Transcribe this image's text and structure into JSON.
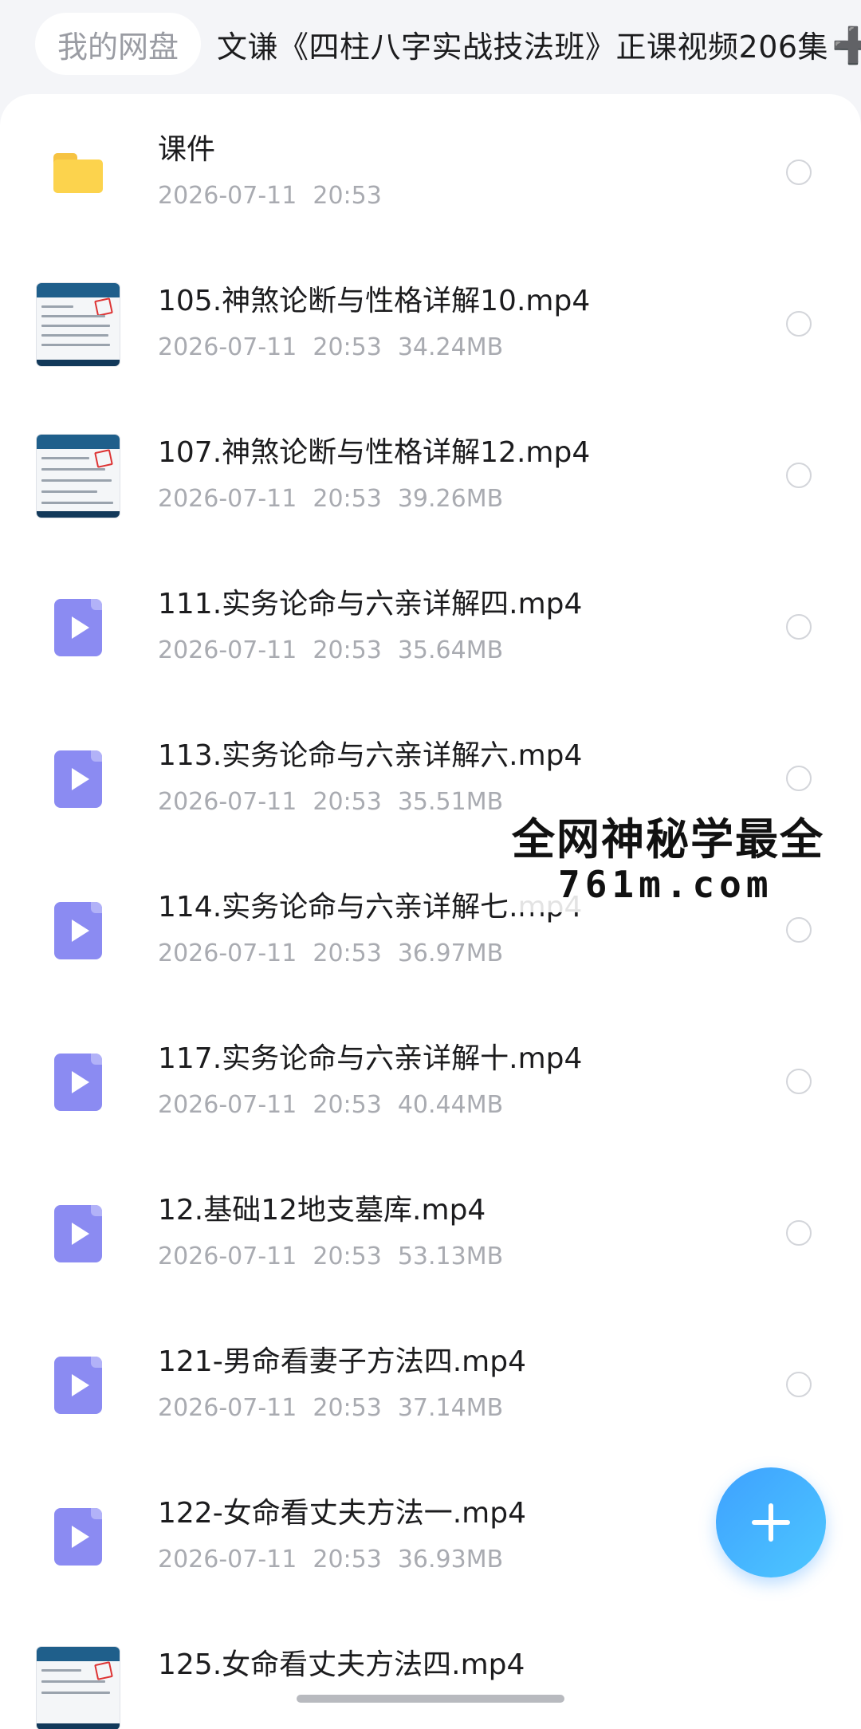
{
  "breadcrumb": {
    "home_label": "我的网盘",
    "current_folder": "文谦《四柱八字实战技法班》正课视频206集",
    "plus_glyph": "➕"
  },
  "files": [
    {
      "name": "课件",
      "date": "2026-07-11",
      "time": "20:53",
      "size": "",
      "icon": "folder-icon"
    },
    {
      "name": "105.神煞论断与性格详解10.mp4",
      "date": "2026-07-11",
      "time": "20:53",
      "size": "34.24MB",
      "icon": "video-thumbnail"
    },
    {
      "name": "107.神煞论断与性格详解12.mp4",
      "date": "2026-07-11",
      "time": "20:53",
      "size": "39.26MB",
      "icon": "video-thumbnail"
    },
    {
      "name": "111.实务论命与六亲详解四.mp4",
      "date": "2026-07-11",
      "time": "20:53",
      "size": "35.64MB",
      "icon": "video-file-icon"
    },
    {
      "name": "113.实务论命与六亲详解六.mp4",
      "date": "2026-07-11",
      "time": "20:53",
      "size": "35.51MB",
      "icon": "video-file-icon"
    },
    {
      "name": "114.实务论命与六亲详解七.mp4",
      "date": "2026-07-11",
      "time": "20:53",
      "size": "36.97MB",
      "icon": "video-file-icon"
    },
    {
      "name": "117.实务论命与六亲详解十.mp4",
      "date": "2026-07-11",
      "time": "20:53",
      "size": "40.44MB",
      "icon": "video-file-icon"
    },
    {
      "name": "12.基础12地支墓库.mp4",
      "date": "2026-07-11",
      "time": "20:53",
      "size": "53.13MB",
      "icon": "video-file-icon"
    },
    {
      "name": "121-男命看妻子方法四.mp4",
      "date": "2026-07-11",
      "time": "20:53",
      "size": "37.14MB",
      "icon": "video-file-icon"
    },
    {
      "name": "122-女命看丈夫方法一.mp4",
      "date": "2026-07-11",
      "time": "20:53",
      "size": "36.93MB",
      "icon": "video-file-icon"
    },
    {
      "name": "125.女命看丈夫方法四.mp4",
      "date": "",
      "time": "",
      "size": "",
      "icon": "video-thumbnail"
    }
  ],
  "watermark": {
    "line1": "全网神秘学最全",
    "line2": "761m.com"
  },
  "fab": {
    "icon": "plus-icon"
  },
  "colors": {
    "accent": "#4aa8ff",
    "folder": "#fcd34d",
    "video_icon": "#8b8bf2",
    "meta_text": "#a9abb1"
  }
}
